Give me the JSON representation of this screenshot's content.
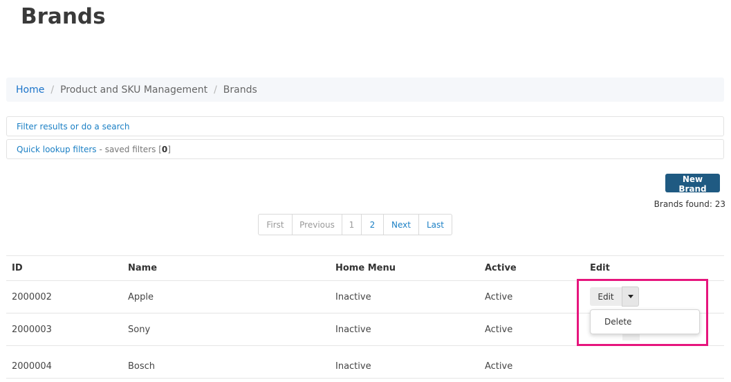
{
  "page": {
    "title": "Brands"
  },
  "breadcrumb": {
    "home": "Home",
    "section": "Product and SKU Management",
    "current": "Brands",
    "separator": "/"
  },
  "filters": {
    "filter_link": "Filter results or do a search",
    "quick_link": "Quick lookup filters",
    "saved_prefix": "- saved filters [",
    "saved_count": "0",
    "saved_suffix": "]"
  },
  "actions": {
    "new_brand": "New Brand"
  },
  "summary": {
    "found": "Brands found: 23"
  },
  "pagination": {
    "first": "First",
    "previous": "Previous",
    "page1": "1",
    "page2": "2",
    "next": "Next",
    "last": "Last"
  },
  "table": {
    "headers": {
      "id": "ID",
      "name": "Name",
      "home_menu": "Home Menu",
      "active": "Active",
      "edit": "Edit"
    },
    "rows": [
      {
        "id": "2000002",
        "name": "Apple",
        "home_menu": "Inactive",
        "active": "Active"
      },
      {
        "id": "2000003",
        "name": "Sony",
        "home_menu": "Inactive",
        "active": "Active"
      },
      {
        "id": "2000004",
        "name": "Bosch",
        "home_menu": "Inactive",
        "active": "Active"
      }
    ],
    "edit_label": "Edit"
  },
  "dropdown": {
    "delete": "Delete"
  },
  "colors": {
    "link": "#1a7fc4",
    "primary_button": "#1f5a82",
    "highlight": "#e6157d"
  }
}
